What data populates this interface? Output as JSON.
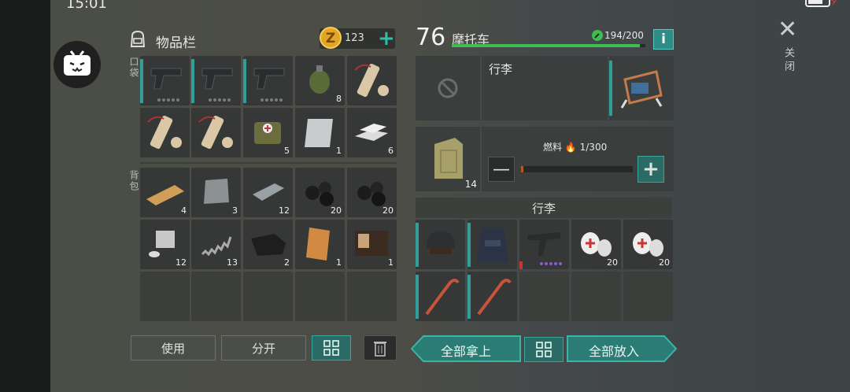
{
  "status": {
    "time": "15:01"
  },
  "inventory": {
    "title": "物品栏",
    "coins": "123",
    "pocket_label": "口袋",
    "backpack_label": "背包",
    "pocket_items": [
      {
        "name": "pistol",
        "qty": ""
      },
      {
        "name": "pistol",
        "qty": ""
      },
      {
        "name": "pistol",
        "qty": ""
      },
      {
        "name": "grenade",
        "qty": "8"
      },
      {
        "name": "dynamite",
        "qty": ""
      },
      {
        "name": "dynamite",
        "qty": ""
      },
      {
        "name": "dynamite",
        "qty": ""
      },
      {
        "name": "medkit-bag",
        "qty": "5"
      },
      {
        "name": "metal-sheet",
        "qty": "1"
      },
      {
        "name": "silver-bars",
        "qty": "6"
      }
    ],
    "backpack_items": [
      {
        "name": "wood-plank",
        "qty": "4"
      },
      {
        "name": "iron-plate",
        "qty": "3"
      },
      {
        "name": "steel-ingot",
        "qty": "12"
      },
      {
        "name": "coal",
        "qty": "20"
      },
      {
        "name": "coal",
        "qty": "20"
      },
      {
        "name": "engine-part",
        "qty": "12"
      },
      {
        "name": "spring",
        "qty": "13"
      },
      {
        "name": "leather",
        "qty": "2"
      },
      {
        "name": "notebook",
        "qty": "1"
      },
      {
        "name": "id-card",
        "qty": "1"
      }
    ],
    "buttons": {
      "use": "使用",
      "split": "分开"
    }
  },
  "vehicle": {
    "level": "76",
    "name": "摩托车",
    "hp": "194/200",
    "hp_fraction": 0.97,
    "luggage_label": "行李",
    "fuel_label": "燃料",
    "fuel_value": "1/300",
    "fuel_fraction": 0.0033,
    "jerrycan_qty": "14",
    "cargo_title": "行李",
    "cargo_items": [
      {
        "name": "helmet",
        "qty": ""
      },
      {
        "name": "police-vest",
        "qty": ""
      },
      {
        "name": "smg",
        "qty": ""
      },
      {
        "name": "bandage",
        "qty": "20"
      },
      {
        "name": "bandage",
        "qty": "20"
      },
      {
        "name": "crowbar",
        "qty": ""
      },
      {
        "name": "crowbar",
        "qty": ""
      }
    ],
    "buttons": {
      "take_all": "全部拿上",
      "put_all": "全部放入"
    }
  },
  "close_label": "关闭",
  "colors": {
    "accent": "#2fbfa6",
    "hp": "#3cbf4e",
    "fuel": "#b35c2a"
  }
}
